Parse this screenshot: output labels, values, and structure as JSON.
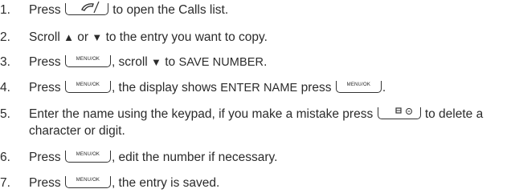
{
  "keys": {
    "menu_ok": "MENU/OK"
  },
  "icons": {
    "talk": "phone-handset-icon",
    "delete": "delete-backspace-icon",
    "up": "up-triangle",
    "down": "down-triangle"
  },
  "steps": [
    {
      "num": "1.",
      "a": "Press",
      "b": "to open the Calls list."
    },
    {
      "num": "2.",
      "a": "Scroll",
      "up": "▲",
      "or": "or",
      "down": "▼",
      "b": "to the entry you want to copy."
    },
    {
      "num": "3.",
      "a": "Press",
      "b": ", scroll",
      "down": "▼",
      "c": "to",
      "caps": "SAVE NUMBER",
      "d": "."
    },
    {
      "num": "4.",
      "a": "Press",
      "b": ", the display shows",
      "caps": "ENTER NAME",
      "c": "press",
      "d": "."
    },
    {
      "num": "5.",
      "a": "Enter the name using the keypad, if you make a mistake press",
      "b": "to delete a",
      "c": "character or digit."
    },
    {
      "num": "6.",
      "a": "Press",
      "b": ", edit the number if necessary."
    },
    {
      "num": "7.",
      "a": "Press",
      "b": ", the entry is saved."
    }
  ]
}
